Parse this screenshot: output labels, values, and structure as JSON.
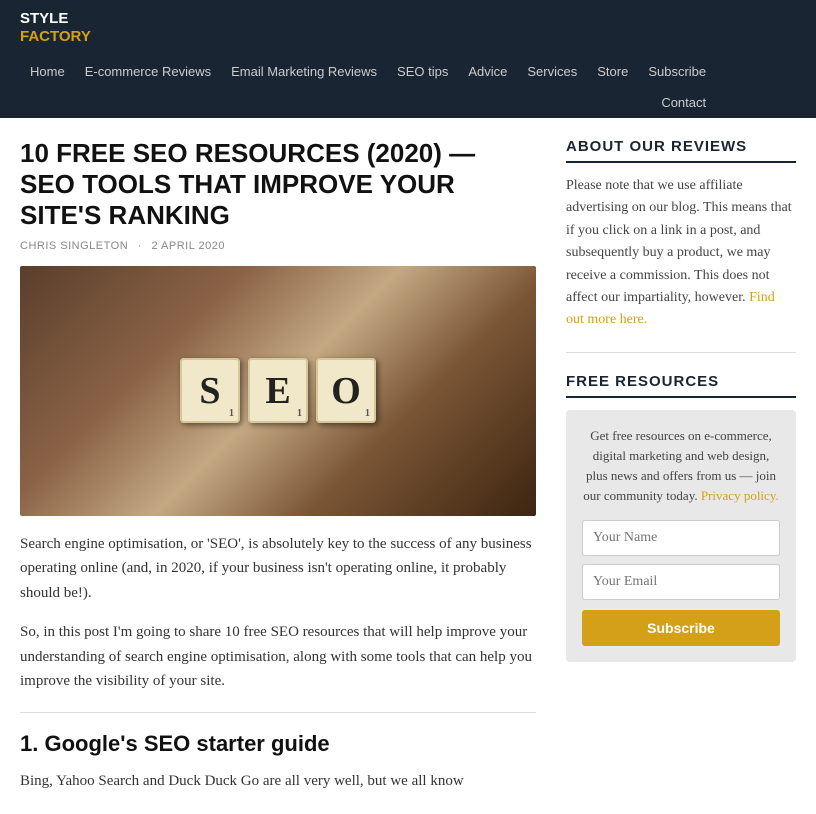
{
  "nav": {
    "logo": {
      "line1": "STYLE",
      "line2": "FACTORY"
    },
    "links_row1": [
      {
        "label": "Home"
      },
      {
        "label": "E-commerce Reviews"
      },
      {
        "label": "Email Marketing Reviews"
      },
      {
        "label": "SEO tips"
      },
      {
        "label": "Advice"
      },
      {
        "label": "Services"
      },
      {
        "label": "Store"
      },
      {
        "label": "Subscribe"
      }
    ],
    "links_row2": [
      {
        "label": "Contact"
      }
    ]
  },
  "article": {
    "title": "10 FREE SEO RESOURCES (2020) — SEO TOOLS THAT IMPROVE YOUR SITE'S RANKING",
    "author": "CHRIS SINGLETON",
    "date": "2 APRIL 2020",
    "body_p1": "Search engine optimisation, or 'SEO', is absolutely key to the success of any business operating online (and, in 2020, if your business isn't operating online, it probably should be!).",
    "body_p2": "So, in this post I'm going to share 10 free SEO resources that will help improve your understanding of search engine optimisation, along with some tools that can help you improve the visibility of your site.",
    "section1_title": "1. Google's SEO starter guide",
    "section1_body": "Bing, Yahoo Search and Duck Duck Go are all very well, but we all know",
    "tiles": [
      {
        "letter": "S",
        "num": "1"
      },
      {
        "letter": "E",
        "num": "1"
      },
      {
        "letter": "O",
        "num": "1"
      }
    ]
  },
  "sidebar": {
    "about_title": "ABOUT OUR REVIEWS",
    "about_text": "Please note that we use affiliate advertising on our blog. This means that if you click on a link in a post, and subsequently buy a product, we may receive a commission. This does not affect our impartiality, however.",
    "about_link": "Find out more here.",
    "free_resources_title": "FREE RESOURCES",
    "free_resources_desc": "Get free resources on e-commerce, digital marketing and web design, plus news and offers from us — join our community today.",
    "privacy_link": "Privacy policy.",
    "name_placeholder": "Your Name",
    "email_placeholder": "Your Email",
    "subscribe_label": "Subscribe"
  }
}
